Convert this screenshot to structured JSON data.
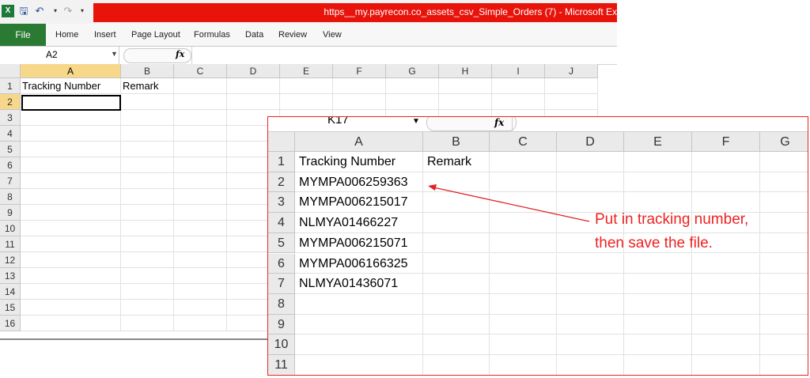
{
  "window": {
    "title": "https__my.payrecon.co_assets_csv_Simple_Orders (7) - Microsoft Ex"
  },
  "ribbon": {
    "file_label": "File",
    "tabs": [
      "Home",
      "Insert",
      "Page Layout",
      "Formulas",
      "Data",
      "Review",
      "View"
    ]
  },
  "formula_bar": {
    "name_box": "A2",
    "fx_label": "fx",
    "value": ""
  },
  "sheet": {
    "columns": [
      "A",
      "B",
      "C",
      "D",
      "E",
      "F",
      "G",
      "H",
      "I",
      "J"
    ],
    "rows": [
      "1",
      "2",
      "3",
      "4",
      "5",
      "6",
      "7",
      "8",
      "9",
      "10",
      "11",
      "12",
      "13",
      "14",
      "15",
      "16"
    ],
    "cells": {
      "A1": "Tracking Number",
      "B1": "Remark"
    },
    "active_cell": "A2"
  },
  "zoom_panel": {
    "name_box": "K17",
    "fx_label": "fx",
    "columns": [
      "A",
      "B",
      "C",
      "D",
      "E",
      "F",
      "G"
    ],
    "rows": [
      "1",
      "2",
      "3",
      "4",
      "5",
      "6",
      "7",
      "8",
      "9",
      "10",
      "11"
    ],
    "header_a": "Tracking Number",
    "header_b": "Remark",
    "tracking_numbers": [
      "MYMPA006259363",
      "MYMPA006215017",
      "NLMYA01466227",
      "MYMPA006215071",
      "MYMPA006166325",
      "NLMYA01436071"
    ]
  },
  "annotation": {
    "line1": "Put in tracking number,",
    "line2": "then save the file.",
    "color": "#e22222"
  },
  "colors": {
    "title_red": "#e8140c",
    "file_tab_green": "#2a7a33",
    "selected_header": "#f7d88a"
  },
  "icons": [
    "excel-icon",
    "save-icon",
    "undo-icon",
    "redo-icon",
    "dropdown-icon"
  ]
}
